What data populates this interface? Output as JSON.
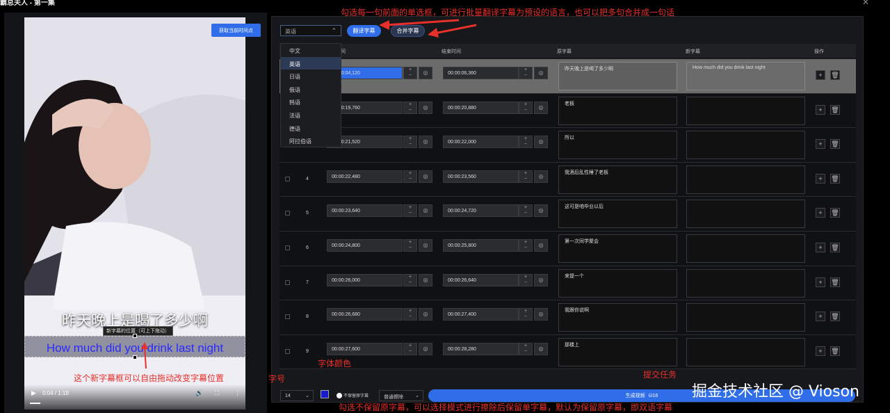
{
  "window": {
    "title": "霸总夫人 - 第一集"
  },
  "video": {
    "now_button": "获取当前时间点",
    "subtitle_original": "昨天晚上是喝了多少啊",
    "subtitle_new": "How much did you drink last night",
    "subtitle_tag": "新字幕的位置（可上下拖动）",
    "time_display": "0:04 / 1:19",
    "progress_fraction": 0.05
  },
  "toolbar": {
    "language_value": "英语",
    "translate_label": "翻译字幕",
    "merge_label": "合并字幕"
  },
  "dropdown": {
    "options": [
      "中文",
      "英语",
      "日语",
      "俄语",
      "韩语",
      "法语",
      "德语",
      "阿拉伯语"
    ],
    "selected": "英语"
  },
  "table": {
    "headers": {
      "start": "开始时间",
      "end": "结束时间",
      "orig": "原字幕",
      "new": "新字幕",
      "ops": "操作"
    },
    "rows": [
      {
        "num": "",
        "start": "00:00:04,120",
        "end": "00:00:06,360",
        "orig": "昨天晚上是喝了多少啊",
        "new": "How much did you drink last night",
        "selected": true
      },
      {
        "num": "",
        "start": "00:00:19,760",
        "end": "00:00:20,880",
        "orig": "老板",
        "new": ""
      },
      {
        "num": "",
        "start": "00:00:21,520",
        "end": "00:00:22,000",
        "orig": "所以",
        "new": ""
      },
      {
        "num": "4",
        "start": "00:00:22,480",
        "end": "00:00:23,560",
        "orig": "我酒后乱性睡了老板",
        "new": ""
      },
      {
        "num": "5",
        "start": "00:00:23,640",
        "end": "00:00:24,720",
        "orig": "这可是咱毕业以后",
        "new": ""
      },
      {
        "num": "6",
        "start": "00:00:24,800",
        "end": "00:00:25,800",
        "orig": "第一次同学聚会",
        "new": ""
      },
      {
        "num": "7",
        "start": "00:00:26,000",
        "end": "00:00:26,640",
        "orig": "来提一个",
        "new": ""
      },
      {
        "num": "8",
        "start": "00:00:26,680",
        "end": "00:00:27,400",
        "orig": "我跟你说啊",
        "new": ""
      },
      {
        "num": "9",
        "start": "00:00:27,600",
        "end": "00:00:28,280",
        "orig": "那楼上",
        "new": ""
      }
    ]
  },
  "bottom": {
    "font_size": "14",
    "keep_toggle": "不保留原字幕",
    "erase_mode": "普通擦除",
    "generate_label": "生成视频",
    "generate_count": "16"
  },
  "annotations": {
    "top": "勾选每一句前面的单选框，可进行批量翻译字幕为预设的语言，也可以把多句合并成一句话",
    "drag": "这个新字幕框可以自由拖动改变字幕位置",
    "font_size": "字号",
    "font_color": "字体颜色",
    "submit": "提交任务",
    "bottom": "勾选不保留原字幕，可以选择模式进行擦除后保留单字幕，默认为保留原字幕，即双语字幕"
  },
  "watermark": "掘金技术社区 @ Vioson",
  "colors": {
    "accent": "#2f6ee8",
    "annotation": "#e8302a",
    "font_color": "#1a1ac8"
  }
}
